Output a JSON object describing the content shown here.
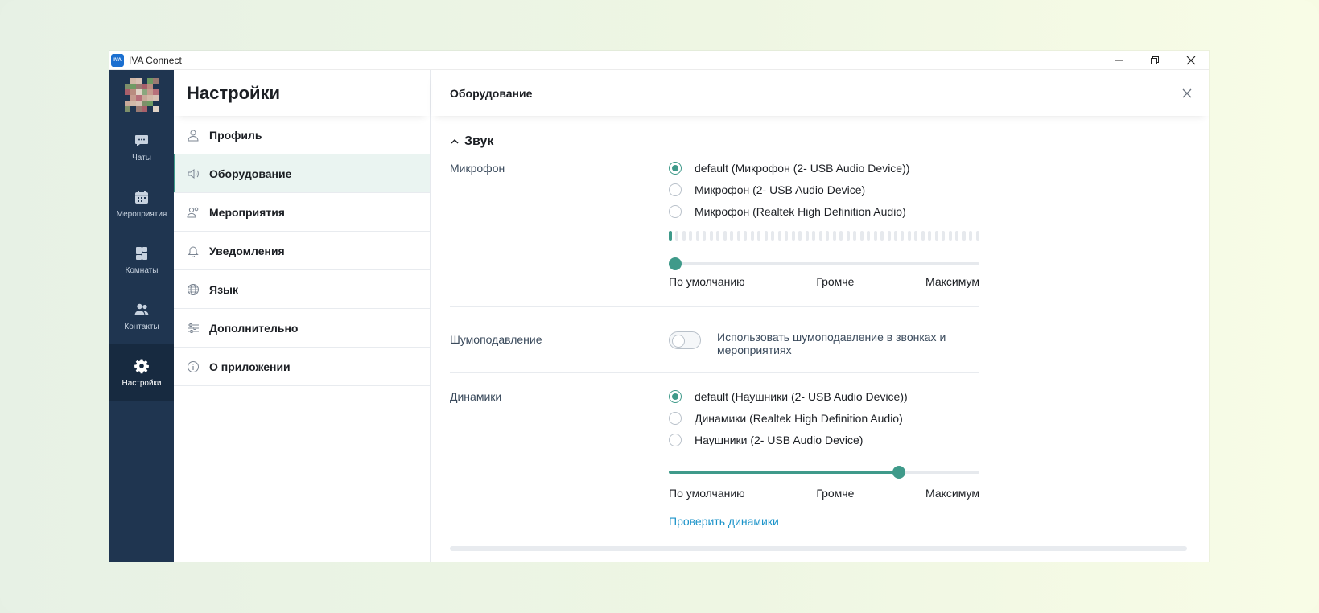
{
  "window": {
    "app_logo": "IVA",
    "app_title": "IVA Connect"
  },
  "rail": {
    "items": [
      {
        "label": "Чаты",
        "icon": "chat-icon"
      },
      {
        "label": "Мероприятия",
        "icon": "calendar-icon"
      },
      {
        "label": "Комнаты",
        "icon": "rooms-icon"
      },
      {
        "label": "Контакты",
        "icon": "contacts-icon"
      },
      {
        "label": "Настройки",
        "icon": "gear-icon",
        "active": true
      }
    ]
  },
  "settings": {
    "title": "Настройки",
    "items": [
      {
        "label": "Профиль",
        "icon": "user-icon"
      },
      {
        "label": "Оборудование",
        "icon": "speaker-icon",
        "active": true
      },
      {
        "label": "Мероприятия",
        "icon": "people-icon"
      },
      {
        "label": "Уведомления",
        "icon": "bell-icon"
      },
      {
        "label": "Язык",
        "icon": "globe-icon"
      },
      {
        "label": "Дополнительно",
        "icon": "sliders-icon"
      },
      {
        "label": "О приложении",
        "icon": "info-icon"
      }
    ]
  },
  "content": {
    "title": "Оборудование",
    "section_title": "Звук",
    "microphone": {
      "label": "Микрофон",
      "options": [
        "default (Микрофон (2- USB Audio Device))",
        "Микрофон (2- USB Audio Device)",
        "Микрофон (Realtek High Definition Audio)"
      ],
      "selected": 0,
      "level_fraction": 0.02,
      "slider_fraction": 0.02,
      "slider_labels": [
        "По умолчанию",
        "Громче",
        "Максимум"
      ]
    },
    "noise": {
      "label": "Шумоподавление",
      "toggle_label": "Использовать шумоподавление в звонках и мероприятиях",
      "enabled": false
    },
    "speakers": {
      "label": "Динамики",
      "options": [
        "default (Наушники (2- USB Audio Device))",
        "Динамики (Realtek High Definition Audio)",
        "Наушники (2- USB Audio Device)"
      ],
      "selected": 0,
      "slider_fraction": 0.74,
      "slider_labels": [
        "По умолчанию",
        "Громче",
        "Максимум"
      ],
      "test_link": "Проверить динамики"
    }
  },
  "colors": {
    "accent": "#3f9a8a",
    "rail_bg": "#1f3550",
    "link": "#1b93c9"
  }
}
